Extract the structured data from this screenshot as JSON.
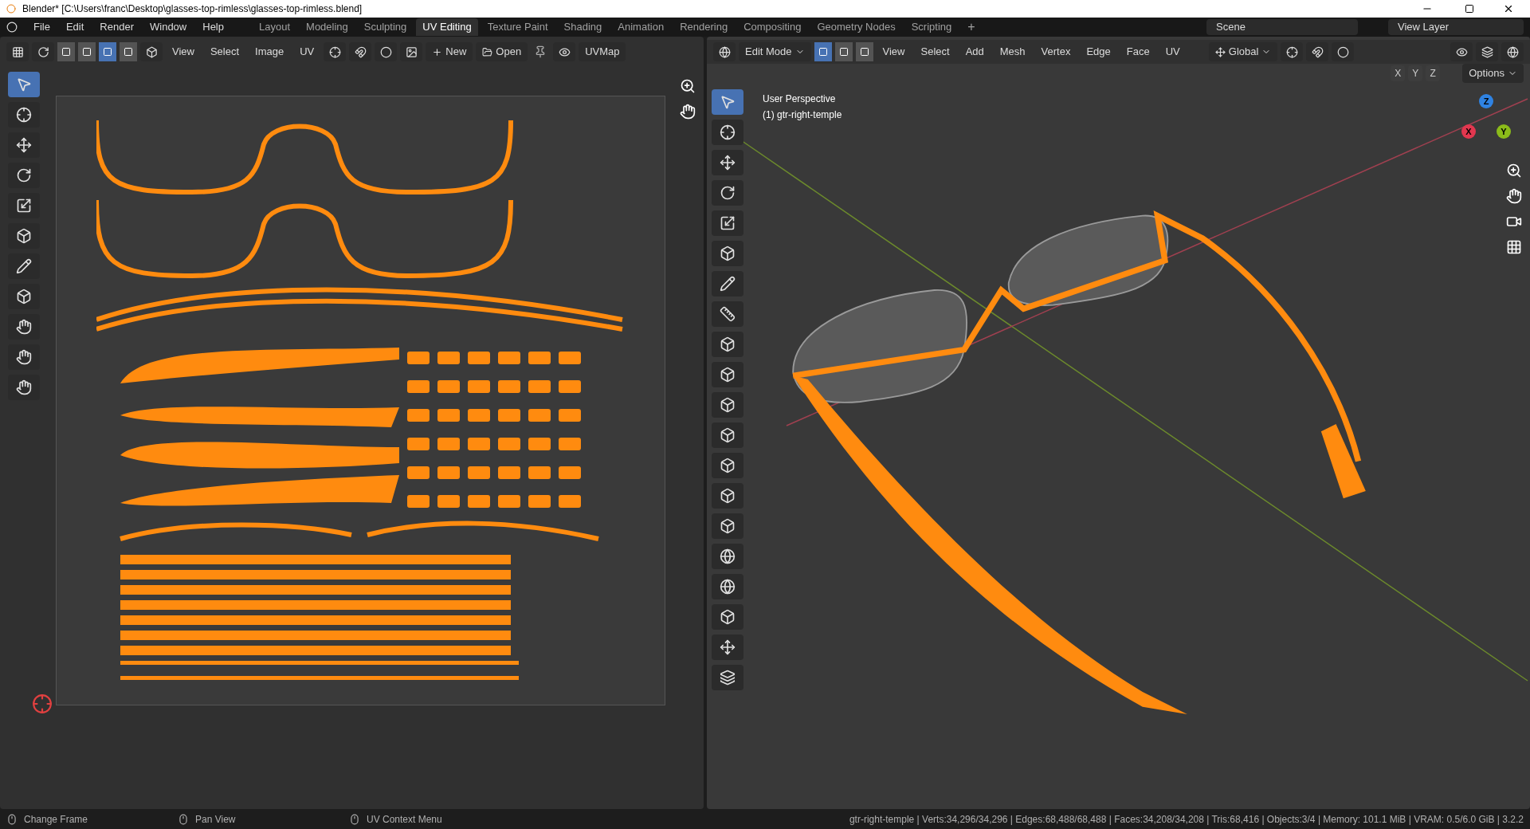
{
  "window": {
    "title": "Blender* [C:\\Users\\franc\\Desktop\\glasses-top-rimless\\glasses-top-rimless.blend]"
  },
  "menu": [
    "File",
    "Edit",
    "Render",
    "Window",
    "Help"
  ],
  "workspaces": [
    {
      "label": "Layout",
      "selected": false
    },
    {
      "label": "Modeling",
      "selected": false
    },
    {
      "label": "Sculpting",
      "selected": false
    },
    {
      "label": "UV Editing",
      "selected": true
    },
    {
      "label": "Texture Paint",
      "selected": false
    },
    {
      "label": "Shading",
      "selected": false
    },
    {
      "label": "Animation",
      "selected": false
    },
    {
      "label": "Rendering",
      "selected": false
    },
    {
      "label": "Compositing",
      "selected": false
    },
    {
      "label": "Geometry Nodes",
      "selected": false
    },
    {
      "label": "Scripting",
      "selected": false
    }
  ],
  "add_workspace": "+",
  "scene": "Scene",
  "view_layer": "View Layer",
  "uv_editor": {
    "menus": [
      "View",
      "Select",
      "Image",
      "UV"
    ],
    "select_modes": [
      {
        "selected": false
      },
      {
        "selected": false
      },
      {
        "selected": true
      },
      {
        "selected": false
      }
    ],
    "new_button": "New",
    "open_button": "Open",
    "uv_map": "UVMap",
    "tools": [
      {
        "selected": true
      },
      {
        "selected": false
      },
      {
        "selected": false
      },
      {
        "selected": false
      },
      {
        "selected": false
      },
      {
        "selected": false
      },
      {
        "selected": false
      },
      {
        "selected": false
      },
      {
        "selected": false
      },
      {
        "selected": false
      },
      {
        "selected": false
      }
    ]
  },
  "viewport": {
    "mode": "Edit Mode",
    "select_modes": [
      {
        "selected": true
      },
      {
        "selected": false
      },
      {
        "selected": false
      }
    ],
    "menus": [
      "View",
      "Select",
      "Add",
      "Mesh",
      "Vertex",
      "Edge",
      "Face",
      "UV"
    ],
    "orientation": "Global",
    "axes": [
      "X",
      "Y",
      "Z"
    ],
    "options": "Options",
    "overlay": [
      "User Perspective",
      "(1) gtr-right-temple"
    ],
    "gizmo": [
      {
        "label": "Z",
        "color": "#2f83e3"
      },
      {
        "label": "X",
        "color": "#e2374f"
      },
      {
        "label": "Y",
        "color": "#8bbb1a"
      }
    ],
    "tools": [
      {
        "selected": true
      },
      {
        "selected": false
      },
      {
        "selected": false
      },
      {
        "selected": false
      },
      {
        "selected": false
      },
      {
        "selected": false
      },
      {
        "selected": false
      },
      {
        "selected": false
      },
      {
        "selected": false
      },
      {
        "selected": false
      },
      {
        "selected": false
      },
      {
        "selected": false
      },
      {
        "selected": false
      },
      {
        "selected": false
      },
      {
        "selected": false
      },
      {
        "selected": false
      },
      {
        "selected": false
      },
      {
        "selected": false
      },
      {
        "selected": false
      },
      {
        "selected": false
      }
    ]
  },
  "status_bar": {
    "hints": [
      "Change Frame",
      "Pan View",
      "UV Context Menu"
    ],
    "stats": "gtr-right-temple | Verts:34,296/34,296 | Edges:68,488/68,488 | Faces:34,208/34,208 | Tris:68,416 | Objects:3/4 | Memory: 101.1 MiB | VRAM: 0.5/6.0 GiB | 3.2.2"
  }
}
